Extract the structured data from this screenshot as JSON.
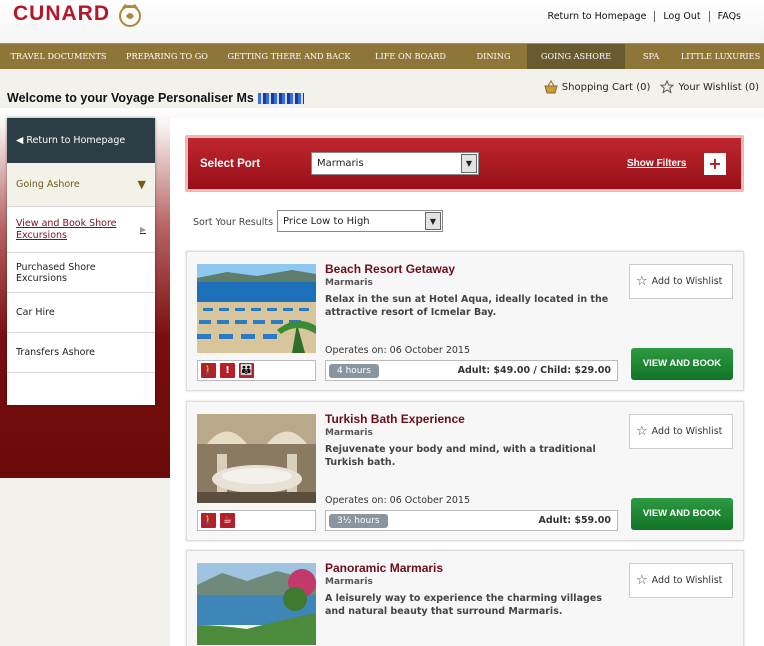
{
  "brand": {
    "logo_text": "CUNARD"
  },
  "top_links": [
    "Return to Homepage",
    "Log Out",
    "FAQs"
  ],
  "nav": {
    "items": [
      "Travel Documents",
      "Preparing to Go",
      "Getting There and Back",
      "Life on Board",
      "Dining",
      "Going Ashore",
      "Spa",
      "Little Luxuries"
    ],
    "active": "Going Ashore"
  },
  "welcome": "Welcome to your Voyage Personaliser Ms",
  "cart": {
    "shopping_cart": "Shopping Cart (0)",
    "wishlist": "Your Wishlist (0)"
  },
  "sidebar": {
    "return": "Return to Homepage",
    "section": "Going Ashore",
    "items": [
      "View and Book Shore Excursions",
      "Purchased Shore Excursions",
      "Car Hire",
      "Transfers Ashore"
    ]
  },
  "filters": {
    "select_port_label": "Select Port",
    "port_value": "Marmaris",
    "show_filters": "Show Filters",
    "sort_label": "Sort Your Results",
    "sort_value": "Price Low to High"
  },
  "excursions": [
    {
      "title": "Beach Resort Getaway",
      "port": "Marmaris",
      "description": "Relax in the sun at Hotel Aqua, ideally located in the attractive resort of Icmelar Bay.",
      "operates": "Operates on:  06 October 2015",
      "duration": "4 hours",
      "price": "Adult: $49.00 / Child: $29.00",
      "wishlist": "Add to Wishlist",
      "book": "VIEW AND BOOK"
    },
    {
      "title": "Turkish Bath Experience",
      "port": "Marmaris",
      "description": "Rejuvenate your body and mind, with a traditional Turkish bath.",
      "operates": "Operates on:  06 October 2015",
      "duration": "3½ hours",
      "price": "Adult: $59.00",
      "wishlist": "Add to Wishlist",
      "book": "VIEW AND BOOK"
    },
    {
      "title": "Panoramic Marmaris",
      "port": "Marmaris",
      "description": "A leisurely way to experience the charming villages and natural beauty that surround Marmaris.",
      "wishlist": "Add to Wishlist"
    }
  ],
  "colors": {
    "brand_red": "#b3182a",
    "nav_gold": "#8e7639",
    "book_green": "#1f8735"
  }
}
